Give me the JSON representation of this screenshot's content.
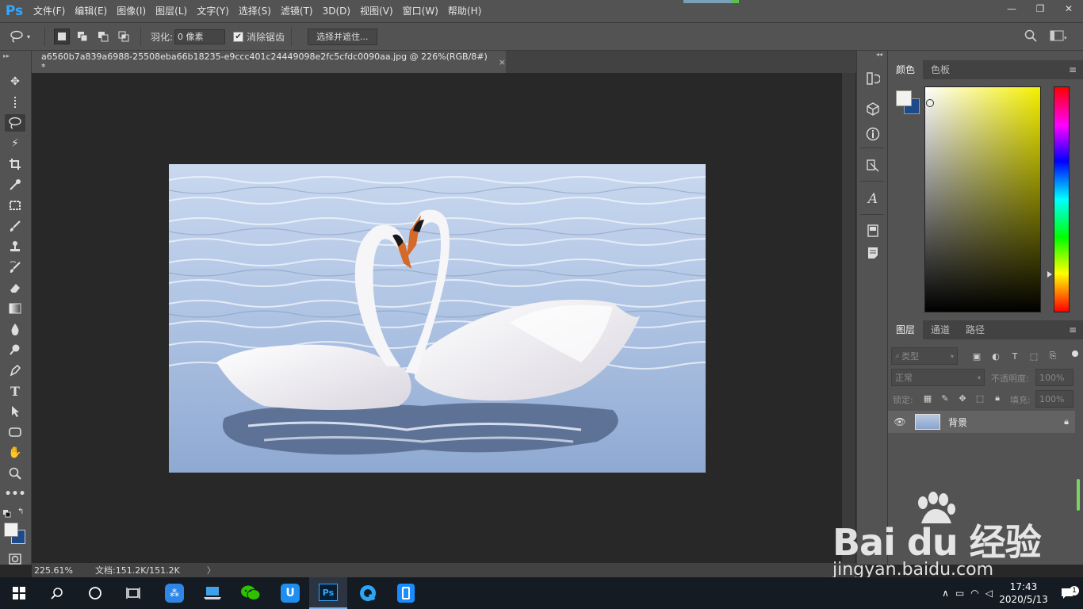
{
  "app": {
    "logo": "Ps"
  },
  "menu": [
    "文件(F)",
    "编辑(E)",
    "图像(I)",
    "图层(L)",
    "文字(Y)",
    "选择(S)",
    "滤镜(T)",
    "3D(D)",
    "视图(V)",
    "窗口(W)",
    "帮助(H)"
  ],
  "window_controls": {
    "minimize": "—",
    "restore": "❐",
    "close": "✕"
  },
  "options": {
    "feather_label": "羽化:",
    "feather_value": "0 像素",
    "antialias_label": "消除锯齿",
    "antialias_checked": true,
    "select_mask_label": "选择并遮住..."
  },
  "document": {
    "tab_title": "a6560b7a839a6988-25508eba66b18235-e9ccc401c24449098e2fc5cfdc0090aa.jpg @ 226%(RGB/8#) *",
    "close": "×"
  },
  "status": {
    "zoom": "225.61%",
    "doc_size": "文档:151.2K/151.2K",
    "arrow": "〉"
  },
  "color_panel": {
    "tabs": [
      "颜色",
      "色板"
    ],
    "active_tab": 0,
    "foreground": "#f2f2ee",
    "background": "#1d4a8a"
  },
  "layers_panel": {
    "tabs": [
      "图层",
      "通道",
      "路径"
    ],
    "active_tab": 0,
    "filter_placeholder": "类型",
    "blend_mode": "正常",
    "opacity_label": "不透明度:",
    "opacity_value": "100%",
    "lock_label": "锁定:",
    "fill_label": "填充:",
    "fill_value": "100%",
    "layers": [
      {
        "name": "背景",
        "visible": true,
        "locked": true
      }
    ]
  },
  "watermark": {
    "brand": "Bai du 经验",
    "url": "jingyan.baidu.com"
  },
  "taskbar": {
    "time": "17:43",
    "date": "2020/5/13",
    "notification_count": "1"
  }
}
